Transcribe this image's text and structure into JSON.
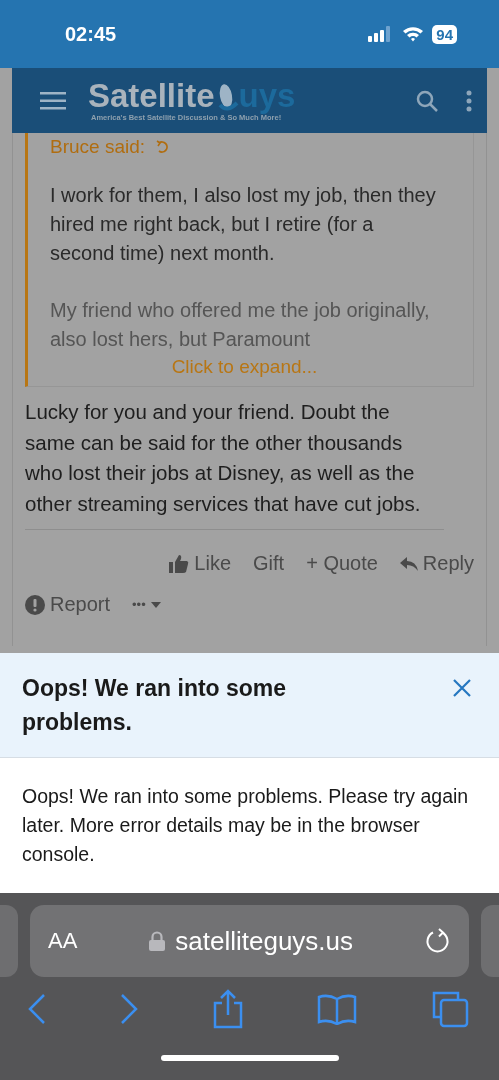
{
  "status_bar": {
    "time": "02:45",
    "battery": "94"
  },
  "header": {
    "logo_left": "Satellite",
    "logo_right": "uys",
    "tagline": "America's Best Satellite Discussion & So Much More!"
  },
  "quote": {
    "author": "Bruce said:",
    "paragraphs": [
      "I work for them, I also lost my job, then they hired me right back, but I retire (for a second time) next month.",
      "My friend who offered me the job originally, also lost hers, but Paramount"
    ],
    "expand": "Click to expand..."
  },
  "post_text": "Lucky for you and your friend. Doubt the same can be said for the other thousands who lost their jobs at Disney, as well as the other streaming services that have cut jobs.",
  "actions": [
    {
      "kind": "like",
      "label": "Like"
    },
    {
      "kind": "plain",
      "label": "Gift"
    },
    {
      "kind": "quote",
      "label": "+ Quote"
    },
    {
      "kind": "reply",
      "label": "Reply"
    }
  ],
  "secondary_actions": [
    {
      "kind": "report",
      "label": "Report"
    },
    {
      "kind": "more",
      "label": "•••"
    }
  ],
  "error": {
    "title": "Oops! We ran into some problems.",
    "message": "Oops! We ran into some problems. Please try again later. More error details may be in the browser console."
  },
  "browser": {
    "text_size": "AA",
    "url": "satelliteguys.us"
  }
}
